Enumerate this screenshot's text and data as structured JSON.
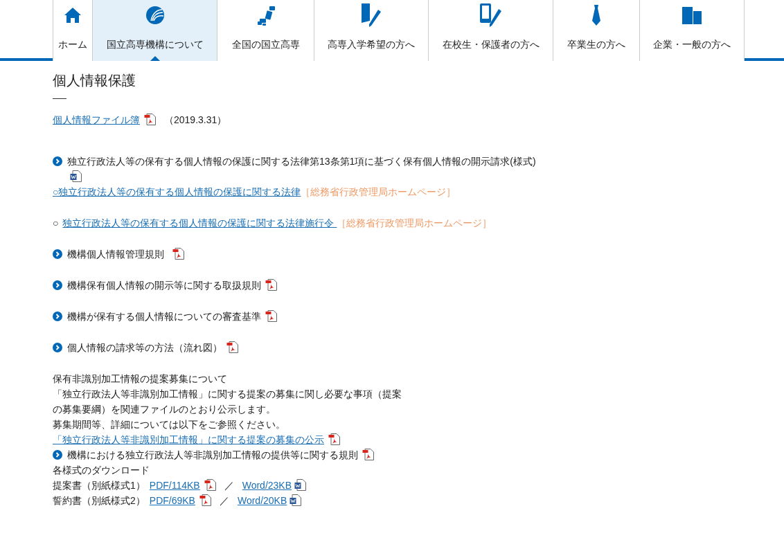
{
  "nav": [
    {
      "label": "ホーム",
      "selected": false
    },
    {
      "label": "国立高専機構について",
      "selected": true
    },
    {
      "label": "全国の国立高専",
      "selected": false
    },
    {
      "label": "高専入学希望の方へ",
      "selected": false
    },
    {
      "label": "在校生・保護者の方へ",
      "selected": false
    },
    {
      "label": "卒業生の方へ",
      "selected": false
    },
    {
      "label": "企業・一般の方へ",
      "selected": false
    }
  ],
  "page_title": "個人情報保護",
  "blocks": [
    {
      "lines": [
        {
          "kind": "line",
          "bullet": false,
          "parts": [
            {
              "kind": "link",
              "text": "個人情報ファイル簿"
            },
            {
              "kind": "pdf"
            },
            {
              "kind": "date",
              "text": "（2019.3.31）"
            }
          ]
        }
      ]
    },
    {
      "lines": [
        {
          "kind": "line",
          "bullet": true,
          "parts": [
            {
              "kind": "text",
              "text": "独立行政法人等の保有する個人情報の保護に関する法律第13条第1項に基づく保有個人情報の開示請求(様式)"
            },
            {
              "kind": "word"
            }
          ]
        },
        {
          "kind": "line",
          "bullet": false,
          "parts": [
            {
              "kind": "link",
              "text": "○独立行政法人等の保有する個人情報の保護に関する法律"
            },
            {
              "kind": "note",
              "text": "［総務省行政管理局ホームページ］"
            }
          ]
        }
      ]
    },
    {
      "lines": [
        {
          "kind": "line",
          "bullet": false,
          "parts": [
            {
              "kind": "text",
              "text": "○"
            },
            {
              "kind": "link",
              "text": "独立行政法人等の保有する個人情報の保護に関する法律施行令 "
            },
            {
              "kind": "note",
              "text": "［総務省行政管理局ホームページ］"
            }
          ]
        }
      ]
    },
    {
      "lines": [
        {
          "kind": "line",
          "bullet": true,
          "parts": [
            {
              "kind": "text",
              "text": "機構個人情報管理規則"
            },
            {
              "kind": "pdf"
            }
          ]
        }
      ]
    },
    {
      "lines": [
        {
          "kind": "line",
          "bullet": true,
          "parts": [
            {
              "kind": "text",
              "text": "機構保有個人情報の開示等に関する取扱規則"
            },
            {
              "kind": "pdf"
            }
          ]
        }
      ]
    },
    {
      "lines": [
        {
          "kind": "line",
          "bullet": true,
          "parts": [
            {
              "kind": "text",
              "text": "機構が保有する個人情報についての審査基準"
            },
            {
              "kind": "pdf"
            }
          ]
        }
      ]
    },
    {
      "lines": [
        {
          "kind": "line",
          "bullet": true,
          "parts": [
            {
              "kind": "text",
              "text": "個人情報の請求等の方法（流れ図）"
            },
            {
              "kind": "pdf"
            }
          ]
        }
      ]
    },
    {
      "lines": [
        {
          "kind": "line",
          "bullet": false,
          "parts": [
            {
              "kind": "text",
              "text": "保有非識別加工情報の提案募集について"
            }
          ]
        },
        {
          "kind": "paragraph",
          "bullet": false,
          "parts": [
            {
              "kind": "text",
              "text": "「独立行政法人等非識別加工情報」に関する提案の募集に関し必要な事項（提案の募集要綱）を関連ファイルのとおり公示します。"
            }
          ]
        },
        {
          "kind": "line",
          "bullet": false,
          "parts": [
            {
              "kind": "text",
              "text": "募集期間等、詳細については以下をご参照ください。"
            }
          ]
        },
        {
          "kind": "line",
          "bullet": false,
          "parts": [
            {
              "kind": "link",
              "text": "「独立行政法人等非識別加工情報」に関する提案の募集の公示"
            },
            {
              "kind": "pdf"
            }
          ]
        },
        {
          "kind": "line",
          "bullet": true,
          "parts": [
            {
              "kind": "text",
              "text": "機構における独立行政法人等非識別加工情報の提供等に関する規則"
            },
            {
              "kind": "pdf"
            }
          ]
        },
        {
          "kind": "line",
          "bullet": false,
          "parts": [
            {
              "kind": "text",
              "text": "各様式のダウンロード"
            }
          ]
        },
        {
          "kind": "line",
          "bullet": false,
          "parts": [
            {
              "kind": "text",
              "text": "提案書（別紙様式1）"
            },
            {
              "kind": "link",
              "text": "PDF/114KB"
            },
            {
              "kind": "pdf"
            },
            {
              "kind": "slash",
              "text": "／"
            },
            {
              "kind": "link",
              "text": "Word/23KB"
            },
            {
              "kind": "word"
            }
          ]
        },
        {
          "kind": "line",
          "bullet": false,
          "parts": [
            {
              "kind": "text",
              "text": "誓約書（別紙様式2）"
            },
            {
              "kind": "link",
              "text": "PDF/69KB"
            },
            {
              "kind": "pdf"
            },
            {
              "kind": "slash",
              "text": "／"
            },
            {
              "kind": "link",
              "text": "Word/20KB"
            },
            {
              "kind": "word"
            }
          ]
        }
      ]
    }
  ]
}
